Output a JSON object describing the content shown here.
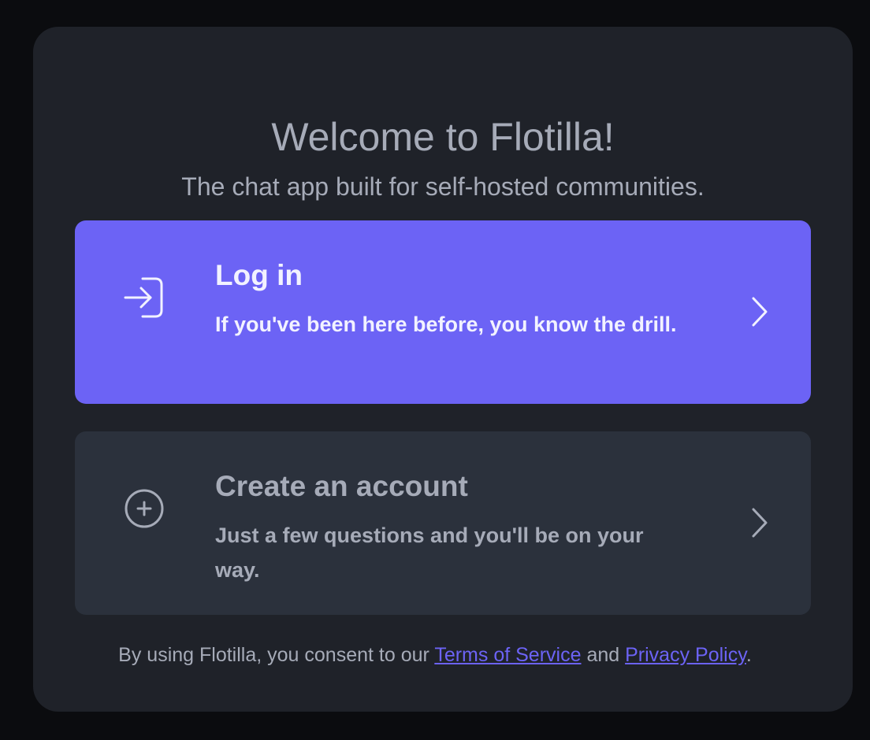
{
  "welcome": {
    "title": "Welcome to Flotilla!",
    "subtitle": "The chat app built for self-hosted communities."
  },
  "options": {
    "login": {
      "title": "Log in",
      "description": "If you've been here before, you know the drill.",
      "icon": "login-arrow-icon"
    },
    "create": {
      "title": "Create an account",
      "description": "Just a few questions and you'll be on your way.",
      "icon": "plus-circle-icon"
    }
  },
  "footer": {
    "prefix": "By using Flotilla, you consent to our ",
    "terms_link": "Terms of Service",
    "middle": " and ",
    "privacy_link": "Privacy Policy",
    "suffix": "."
  },
  "colors": {
    "accent": "#6c63f5",
    "modal_bg": "#1f2229",
    "card_bg": "#2b313c",
    "text_muted": "#a6abb8"
  }
}
